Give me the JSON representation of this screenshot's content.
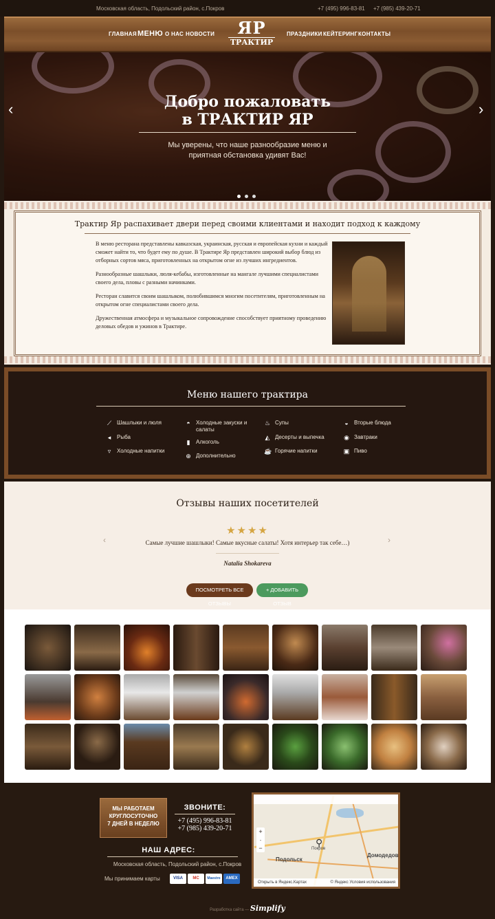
{
  "topbar": {
    "address": "Московская область, Подольский район, с.Покров",
    "phone1": "+7 (495) 996-83-81",
    "phone2": "+7 (985) 439-20-71"
  },
  "nav": {
    "home": "Главная",
    "menu": "Меню",
    "about": "О нас",
    "news": "Новости",
    "holidays": "Праздники",
    "catering": "Кейтеринг",
    "contacts": "Контакты"
  },
  "logo": {
    "line1": "ЯР",
    "line2": "ТРАКТИР"
  },
  "hero": {
    "title1": "Добро пожаловать",
    "title2": "в ТРАКТИР ЯР",
    "sub1": "Мы уверены, что наше разнообразие меню и",
    "sub2": "приятная обстановка удивят Вас!",
    "prev": "‹",
    "next": "›"
  },
  "intro": {
    "heading": "Трактир Яр распахивает двери перед своими клиентами и находит подход к каждому",
    "p1": "В меню ресторана представлены кавказская, украинская, русская и европейская кухни и каждый сможет найти то, что будет ему по душе. В Трактире Яр представлен широкий выбор блюд из отборных сортов мяса, приготовленных на открытом огне из лучших ингредиентов.",
    "p2": "Разнообразные шашлыки, люля-кебабы, изготовленные на мангале лучшими специалистами своего дела, пловы с разными начинками.",
    "p3": "Ресторан славится своим шашлыком, полюбившимся многим посетителям, приготовленным на открытом огне специалистами своего дела.",
    "p4": "Дружественная атмосфера и музыкальное сопровождение способствует приятному проведению деловых обедов и ужинов в Трактире."
  },
  "menu": {
    "title": "Меню нашего трактира",
    "items": [
      "Шашлыки и люля",
      "Холодные закуски и салаты",
      "Супы",
      "Вторые блюда",
      "Рыба",
      "Алкоголь",
      "Десерты и выпечка",
      "Завтраки",
      "Холодные напитки",
      "Дополнительно",
      "Горячие напитки",
      "Пиво"
    ]
  },
  "reviews": {
    "title": "Отзывы наших посетителей",
    "stars": "★★★★",
    "rating": 4,
    "quote": "Самые лучшие шашлыки! Самые вкусные салаты! Хотя интерьер так себе…)",
    "author": "Natalia Shokareva",
    "btn_all": "Посмотреть все отзывы",
    "btn_add": "+ Добавить отзыв",
    "prev": "‹",
    "next": "›"
  },
  "footer": {
    "hours1": "Мы работаем",
    "hours2": "круглосуточно",
    "hours3": "7 дней в неделю",
    "call": "ЗВОНИТЕ:",
    "phone1": "+7 (495) 996-83-81",
    "phone2": "+7 (985) 439-20-71",
    "addr_heading": "НАШ АДРЕС:",
    "address": "Московская область, Подольский район, с.Покров",
    "cards_label": "Мы принимаем карты",
    "card_visa": "VISA",
    "card_mc": "MC",
    "card_maestro": "Maestro",
    "card_amex": "AMEX",
    "map_open": "Открыть в Яндекс.Картах",
    "map_terms": "© Яндекс Условия использования",
    "map_podolsk": "Подольск",
    "map_domodedovo": "Домодедово",
    "map_pokrov": "Покров",
    "credit": "Разработка сайта —",
    "credit_brand": "Simplify"
  }
}
